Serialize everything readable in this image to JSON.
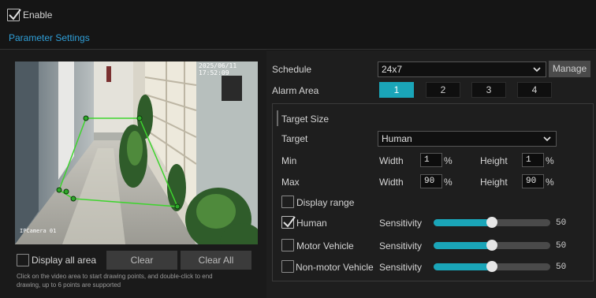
{
  "header": {
    "enable_label": "Enable",
    "enable_checked": true,
    "tab_label": "Parameter Settings"
  },
  "video": {
    "timestamp": "2025/06/11 17:52:09",
    "camera_label": "IPCamera 01"
  },
  "video_controls": {
    "display_all_area_label": "Display all area",
    "clear_label": "Clear",
    "clear_all_label": "Clear All",
    "hint_line1": "Click on the video area to start drawing points, and double-click to end",
    "hint_line2": "drawing, up to 6 points are supported"
  },
  "settings": {
    "schedule_label": "Schedule",
    "schedule_value": "24x7",
    "manage_label": "Manage",
    "alarm_area_label": "Alarm Area",
    "alarm_areas": [
      "1",
      "2",
      "3",
      "4"
    ],
    "alarm_area_active": "1",
    "target_size_title": "Target Size",
    "target_label": "Target",
    "target_value": "Human",
    "min_label": "Min",
    "max_label": "Max",
    "width_label": "Width",
    "height_label": "Height",
    "min_width": "1",
    "min_height": "1",
    "max_width": "90",
    "max_height": "90",
    "percent": "%",
    "display_range_label": "Display range",
    "sensitivity_label": "Sensitivity",
    "targets": [
      {
        "name": "Human",
        "checked": true,
        "sensitivity": "50"
      },
      {
        "name": "Motor Vehicle",
        "checked": false,
        "sensitivity": "50"
      },
      {
        "name": "Non-motor Vehicle",
        "checked": false,
        "sensitivity": "50"
      }
    ],
    "sensitivity_max": 100
  },
  "colors": {
    "accent": "#1aa5b8",
    "tab_text": "#2f9fd8",
    "region_line": "#3ed42e"
  }
}
